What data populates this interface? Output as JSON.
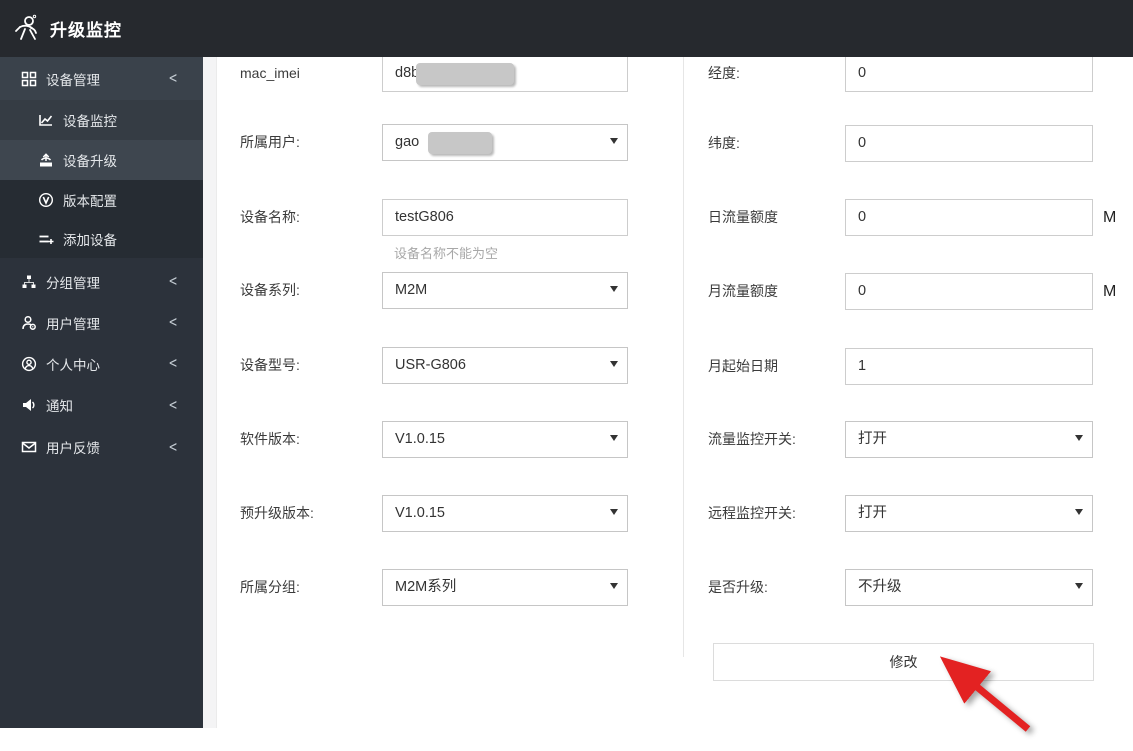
{
  "app": {
    "title": "升级监控",
    "logo_icon": "usr-figure-logo"
  },
  "colors": {
    "header_bg": "#26292e",
    "sidebar_bg": "#2c323b",
    "sidebar_active_bg": "#3e464f",
    "annotation_arrow": "#e32222",
    "redaction_gray": "#c7c7c7"
  },
  "sidebar": {
    "items": [
      {
        "label": "设备管理",
        "icon": "grid-icon",
        "level": "parent",
        "chevron": "<",
        "state": "expanded"
      },
      {
        "label": "设备监控",
        "icon": "line-chart-icon",
        "level": "sub"
      },
      {
        "label": "设备升级",
        "icon": "device-upgrade-icon",
        "level": "sub",
        "state": "active"
      },
      {
        "label": "版本配置",
        "icon": "version-config-icon",
        "level": "sub"
      },
      {
        "label": "添加设备",
        "icon": "add-device-icon",
        "level": "sub"
      },
      {
        "label": "分组管理",
        "icon": "group-tree-icon",
        "level": "parent",
        "chevron": "<"
      },
      {
        "label": "用户管理",
        "icon": "user-manage-icon",
        "level": "parent",
        "chevron": "<"
      },
      {
        "label": "个人中心",
        "icon": "profile-icon",
        "level": "parent",
        "chevron": "<"
      },
      {
        "label": "通知",
        "icon": "megaphone-icon",
        "level": "parent",
        "chevron": "<"
      },
      {
        "label": "用户反馈",
        "icon": "envelope-icon",
        "level": "parent",
        "chevron": "<"
      }
    ]
  },
  "form": {
    "left": [
      {
        "label": "mac_imei",
        "type": "text",
        "value": "d8b",
        "redacted": true
      },
      {
        "label": "所属用户:",
        "type": "select",
        "value": "gao",
        "redacted": true
      },
      {
        "label": "设备名称:",
        "type": "text",
        "value": "testG806",
        "hint": "设备名称不能为空"
      },
      {
        "label": "设备系列:",
        "type": "select",
        "value": "M2M"
      },
      {
        "label": "设备型号:",
        "type": "select",
        "value": "USR-G806"
      },
      {
        "label": "软件版本:",
        "type": "select",
        "value": "V1.0.15"
      },
      {
        "label": "预升级版本:",
        "type": "select",
        "value": "V1.0.15"
      },
      {
        "label": "所属分组:",
        "type": "select",
        "value": "M2M系列"
      }
    ],
    "right": [
      {
        "label": "经度:",
        "type": "text",
        "value": "0"
      },
      {
        "label": "纬度:",
        "type": "text",
        "value": "0"
      },
      {
        "label": "日流量额度",
        "type": "text",
        "value": "0",
        "suffix": "M"
      },
      {
        "label": "月流量额度",
        "type": "text",
        "value": "0",
        "suffix": "M"
      },
      {
        "label": "月起始日期",
        "type": "text",
        "value": "1"
      },
      {
        "label": "流量监控开关:",
        "type": "select",
        "value": "打开"
      },
      {
        "label": "远程监控开关:",
        "type": "select",
        "value": "打开"
      },
      {
        "label": "是否升级:",
        "type": "select",
        "value": "不升级"
      }
    ],
    "submit_label": "修改"
  }
}
